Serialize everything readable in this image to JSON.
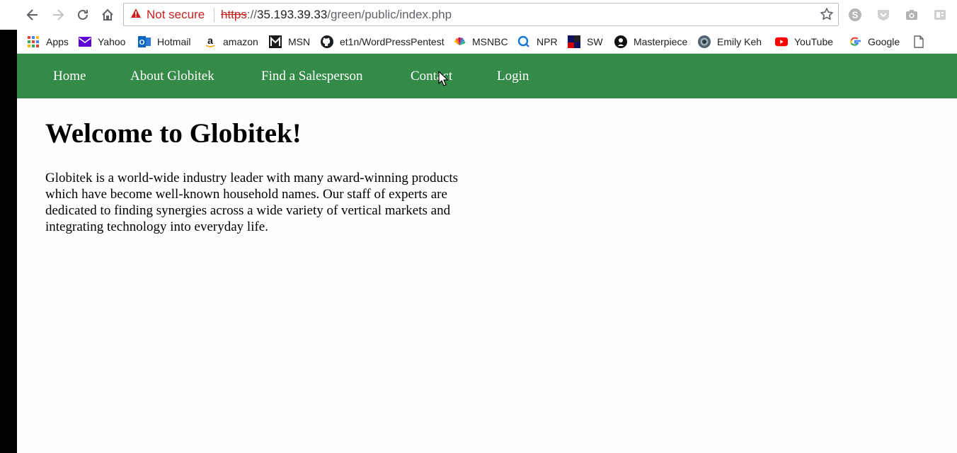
{
  "browser": {
    "security_label": "Not secure",
    "url": {
      "scheme": "https",
      "separator": "://",
      "host": "35.193.39.33",
      "path": "/green/public/index.php"
    },
    "nav_icons": [
      "back-arrow-icon",
      "forward-arrow-icon",
      "reload-icon",
      "home-icon"
    ],
    "extension_icons": [
      "skype-icon",
      "shield-icon",
      "camera-icon",
      "reader-icon"
    ]
  },
  "bookmarks": [
    {
      "label": "Apps",
      "icon": "apps-grid-icon"
    },
    {
      "label": "Yahoo",
      "icon": "yahoo-mail-icon"
    },
    {
      "label": "Hotmail",
      "icon": "outlook-icon"
    },
    {
      "label": "amazon",
      "icon": "amazon-icon"
    },
    {
      "label": "MSN",
      "icon": "msn-icon"
    },
    {
      "label": "et1n/WordPressPentest",
      "icon": "github-icon"
    },
    {
      "label": "MSNBC",
      "icon": "msnbc-peacock-icon"
    },
    {
      "label": "NPR",
      "icon": "npr-icon"
    },
    {
      "label": "SW",
      "icon": "sw-icon"
    },
    {
      "label": "Masterpiece",
      "icon": "pbs-icon"
    },
    {
      "label": "Emily Keh",
      "icon": "emily-keh-icon"
    },
    {
      "label": "YouTube",
      "icon": "youtube-icon"
    },
    {
      "label": "Google",
      "icon": "google-icon"
    },
    {
      "label": "",
      "icon": "page-icon"
    }
  ],
  "site": {
    "nav": [
      "Home",
      "About Globitek",
      "Find a Salesperson",
      "Contact",
      "Login"
    ],
    "heading": "Welcome to Globitek!",
    "intro": "Globitek is a world-wide industry leader with many award-winning products which have become well-known household names. Our staff of experts are dedicated to finding synergies across a wide variety of vertical markets and integrating technology into everyday life."
  },
  "colors": {
    "navbar": "#348a47",
    "not_secure": "#c5221f"
  }
}
